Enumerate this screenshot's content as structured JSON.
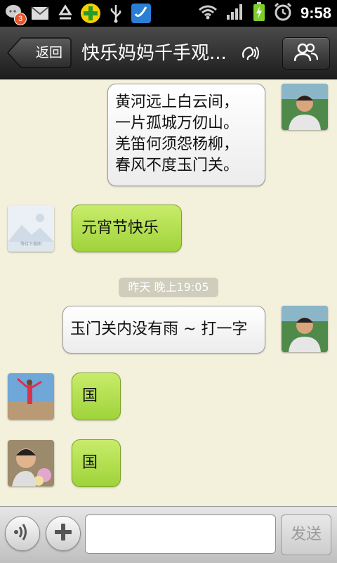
{
  "status_bar": {
    "notification_count": "3",
    "time": "9:58",
    "icons": [
      "chat-notification-icon",
      "mail-icon",
      "recycle-icon",
      "plus-app-icon",
      "usb-icon",
      "app-check-icon",
      "wifi-icon",
      "signal-icon",
      "battery-charging-icon",
      "alarm-icon"
    ]
  },
  "header": {
    "back_label": "返回",
    "title": "快乐妈妈千手观...",
    "earpiece_icon": "earpiece-mode-icon",
    "members_icon": "group-members-icon"
  },
  "messages": [
    {
      "side": "right",
      "type": "text",
      "lines": [
        "黄河远上白云间，",
        "一片孤城万仞山。",
        "羌笛何须怨杨柳，",
        "春风不度玉门关。"
      ],
      "avatar": "man-photo"
    },
    {
      "side": "left",
      "type": "text",
      "lines": [
        "元宵节快乐"
      ],
      "avatar": "placeholder",
      "avatar_caption": "等待下载图"
    },
    {
      "side": "center",
      "type": "timestamp",
      "text": "昨天 晚上19:05"
    },
    {
      "side": "right",
      "type": "text",
      "lines": [
        "玉门关内没有雨 ~ 打一字"
      ],
      "avatar": "man-photo"
    },
    {
      "side": "left",
      "type": "text",
      "lines": [
        "国"
      ],
      "avatar": "beach-photo"
    },
    {
      "side": "left",
      "type": "text",
      "lines": [
        "国"
      ],
      "avatar": "child-photo"
    }
  ],
  "input_bar": {
    "voice_icon": "voice-input-icon",
    "plus_icon": "add-attachment-icon",
    "input_value": "",
    "send_label": "发送"
  },
  "colors": {
    "chat_background": "#f3f0dc",
    "green_bubble": "#a8d948",
    "white_bubble": "#ffffff",
    "titlebar": "#2a2a2a"
  }
}
